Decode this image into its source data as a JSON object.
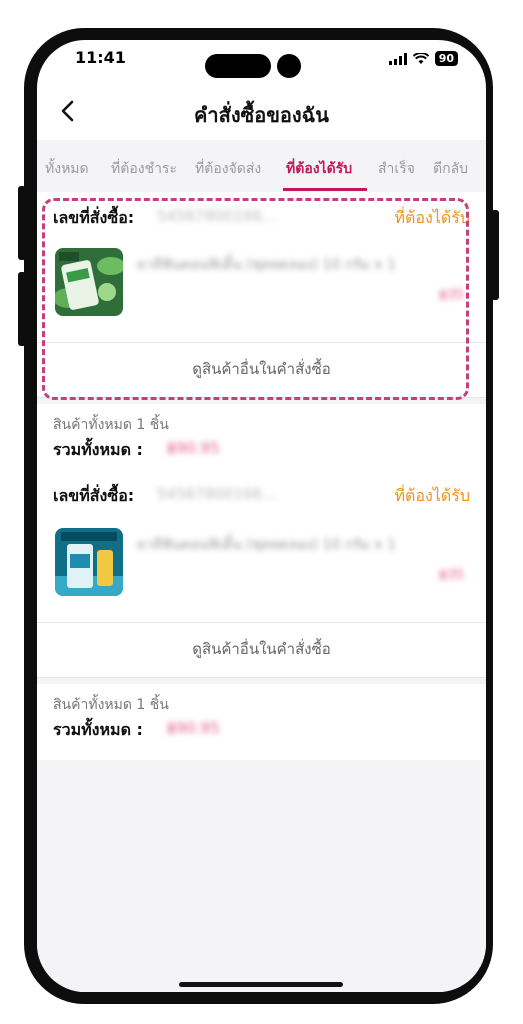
{
  "status_bar": {
    "time": "11:41",
    "battery": "90"
  },
  "header": {
    "title": "คำสั่งซื้อของฉัน"
  },
  "tabs": [
    {
      "label": "ทั้งหมด"
    },
    {
      "label": "ที่ต้องชำระ"
    },
    {
      "label": "ที่ต้องจัดส่ง"
    },
    {
      "label": "ที่ต้องได้รับ",
      "active": true
    },
    {
      "label": "สำเร็จ"
    },
    {
      "label": "ตีกลับ"
    }
  ],
  "orders": [
    {
      "order_label": "เลขที่สั่งซื้อ:",
      "order_number": "54567800166...",
      "status": "ที่ต้องได้รับ",
      "product_name": "ยาสีฟันคอนฟิเดิ้น (ชุดทดลอง) 10 กรัม x 1",
      "price": "฿35",
      "view_more": "ดูสินค้าอื่นในคำสั่งซื้อ",
      "items_count": "สินค้าทั้งหมด 1 ชิ้น",
      "total_label": "รวมทั้งหมด :",
      "total_value": "฿90.95"
    },
    {
      "order_label": "เลขที่สั่งซื้อ:",
      "order_number": "54567800166...",
      "status": "ที่ต้องได้รับ",
      "product_name": "ยาสีฟันคอนฟิเดิ้น (ชุดทดลอง) 10 กรัม x 1",
      "price": "฿35",
      "view_more": "ดูสินค้าอื่นในคำสั่งซื้อ",
      "items_count": "สินค้าทั้งหมด 1 ชิ้น",
      "total_label": "รวมทั้งหมด :",
      "total_value": "฿90.95"
    }
  ],
  "colors": {
    "accent": "#c2185b",
    "status": "#f0921a",
    "highlight": "#c5407a"
  }
}
